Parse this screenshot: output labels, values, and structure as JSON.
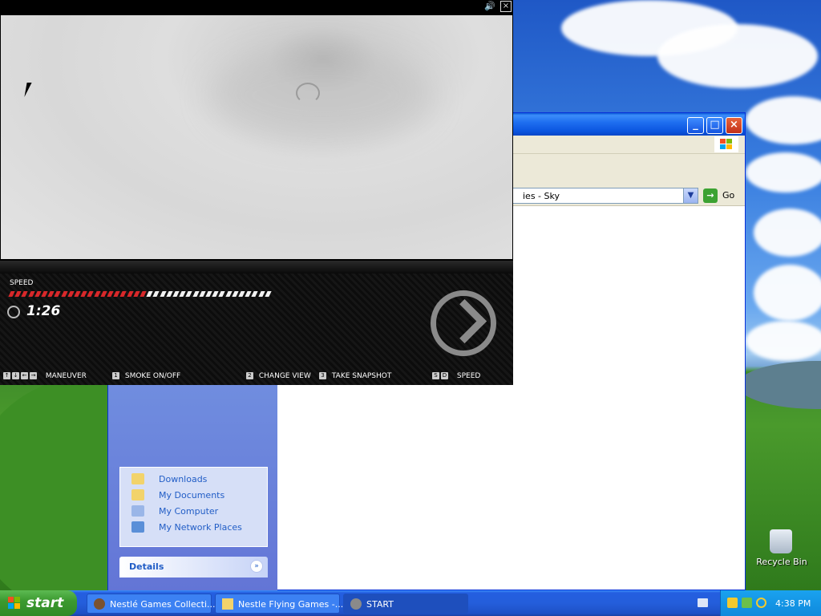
{
  "game": {
    "speed_label": "SPEED",
    "timer": "1:26",
    "speed_level": 0.52,
    "controls": [
      {
        "keys": [
          "↑",
          "↓",
          "←",
          "→"
        ],
        "label": "MANEUVER"
      },
      {
        "keys": [
          "1"
        ],
        "label": "SMOKE ON/OFF"
      },
      {
        "keys": [
          "2"
        ],
        "label": "CHANGE VIEW"
      },
      {
        "keys": [
          "3"
        ],
        "label": "TAKE SNAPSHOT"
      },
      {
        "keys": [
          "S",
          "D"
        ],
        "label": "SPEED"
      }
    ]
  },
  "explorer": {
    "address_text": "ies - Sky",
    "go_label": "Go",
    "places": [
      "Downloads",
      "My Documents",
      "My Computer",
      "My Network Places"
    ],
    "details_title": "Details"
  },
  "desktop": {
    "recycle_bin": "Recycle Bin"
  },
  "taskbar": {
    "start_label": "start",
    "buttons": [
      "Nestlé Games Collecti...",
      "Nestle Flying Games -...",
      "START"
    ],
    "clock": "4:38 PM"
  }
}
